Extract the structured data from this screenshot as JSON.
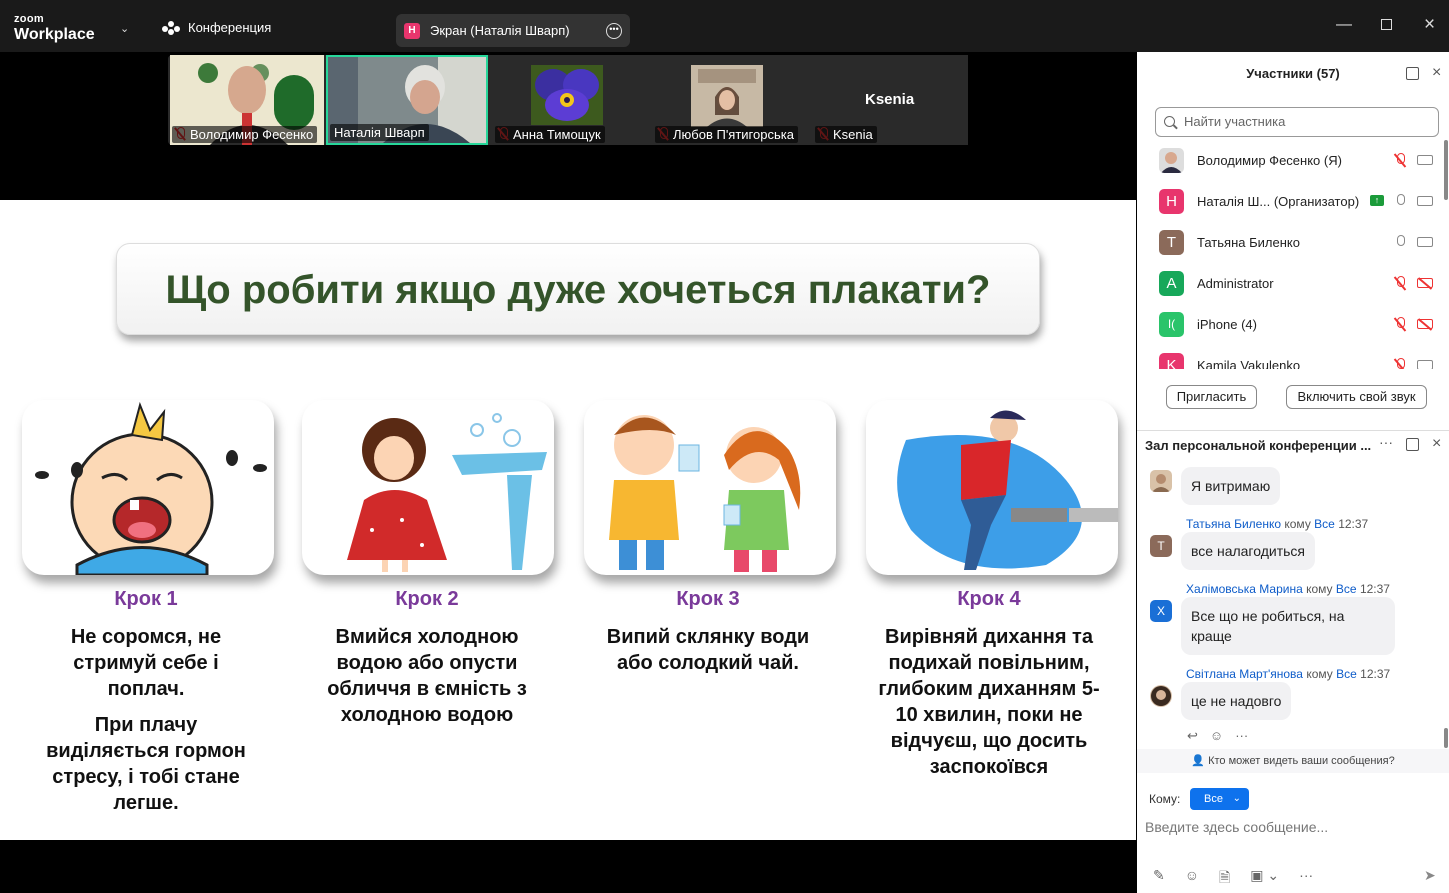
{
  "app": {
    "brand_small": "zoom",
    "brand_big": "Workplace"
  },
  "topbar": {
    "conference_label": "Конференция",
    "share_label": "Экран (Наталія Шварп)",
    "share_badge": "H"
  },
  "videos": [
    {
      "name": "Володимир Фесенко",
      "muted": true
    },
    {
      "name": "Наталія Шварп",
      "muted": false,
      "active": true
    },
    {
      "name": "Анна Тимощук",
      "muted": true
    },
    {
      "name": "Любов П'ятигорська",
      "muted": true
    },
    {
      "name": "Ksenia",
      "muted": true,
      "big_name": "Ksenia"
    }
  ],
  "slide": {
    "title": "Що робити якщо дуже хочеться плакати?",
    "steps": [
      {
        "label": "Крок 1",
        "text": [
          "Не соромся, не стримуй себе і поплач.",
          "При плачу виділяється гормон стресу, і тобі стане легше."
        ]
      },
      {
        "label": "Крок 2",
        "text": [
          "Вмийся холодною водою або опусти обличчя в ємність з холодною водою"
        ]
      },
      {
        "label": "Крок 3",
        "text": [
          "Випий склянку води або солодкий чай."
        ]
      },
      {
        "label": "Крок 4",
        "text": [
          "Вирівняй дихання та подихай повільним, глибоким диханням 5-10 хвилин, поки не відчуєш, що досить заспокоївся"
        ]
      }
    ]
  },
  "participants": {
    "title": "Участники (57)",
    "search_placeholder": "Найти участника",
    "list": [
      {
        "initial": "",
        "name": "Володимир Фесенко (Я)",
        "color": "#9a8a7a",
        "mic_off": true,
        "cam_off": false
      },
      {
        "initial": "H",
        "name": "Наталія Ш...   (Организатор)",
        "color": "#e8356d",
        "mic_off": false,
        "cam_off": false,
        "sharing": true
      },
      {
        "initial": "T",
        "name": "Татьяна Биленко",
        "color": "#8b6a5a",
        "mic_off": false,
        "cam_off": false
      },
      {
        "initial": "A",
        "name": "Administrator",
        "color": "#17a85a",
        "mic_off": true,
        "cam_off": true
      },
      {
        "initial": "I(",
        "name": "iPhone (4)",
        "color": "#2ac46a",
        "mic_off": true,
        "cam_off": true
      },
      {
        "initial": "K",
        "name": "Kamila Vakulenko",
        "color": "#e8356d",
        "mic_off": true,
        "cam_off": false
      }
    ],
    "invite_label": "Пригласить",
    "unmute_label": "Включить свой звук"
  },
  "chat": {
    "title": "Зал персональной конференции ...",
    "messages": [
      {
        "sender": "",
        "to": "",
        "time": "",
        "text": "Я витримаю",
        "avatar": "",
        "color": "#b59a7e"
      },
      {
        "sender": "Татьяна Биленко",
        "to": "Все",
        "time": "12:37",
        "text": "все налагодиться",
        "avatar": "T",
        "color": "#8b6a5a"
      },
      {
        "sender": "Халімовська Марина",
        "to": "Все",
        "time": "12:37",
        "text": "Все що не робиться, на краще",
        "avatar": "X",
        "color": "#1a6fd6"
      },
      {
        "sender": "Світлана Март'янова",
        "to": "Все",
        "time": "12:37",
        "text": "це не надовго",
        "avatar": "",
        "color": "#3a2a20"
      }
    ],
    "to_word": "кому",
    "privacy_text": "Кто может видеть ваши сообщения?",
    "recipient_label": "Кому:",
    "recipient_value": "Все",
    "input_placeholder": "Введите здесь сообщение..."
  }
}
